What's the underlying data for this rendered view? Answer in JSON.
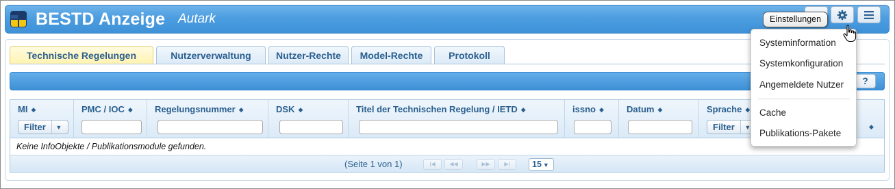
{
  "app": {
    "title": "BESTD Anzeige",
    "subtitle": "Autark"
  },
  "header": {
    "tooltip": "Einstellungen",
    "buttons": [
      {
        "icon": "gear-icon"
      },
      {
        "icon": "hamburger-menu-icon"
      }
    ]
  },
  "tabs": [
    {
      "label": "Technische Regelungen",
      "active": true
    },
    {
      "label": "Nutzerverwaltung",
      "active": false
    },
    {
      "label": "Nutzer-Rechte",
      "active": false
    },
    {
      "label": "Model-Rechte",
      "active": false
    },
    {
      "label": "Protokoll",
      "active": false
    }
  ],
  "toolbar": {
    "help_label": "?"
  },
  "grid": {
    "columns": [
      {
        "label": "MI",
        "filter": "select",
        "filter_label": "Filter"
      },
      {
        "label": "PMC / IOC",
        "filter": "text",
        "value": ""
      },
      {
        "label": "Regelungsnummer",
        "filter": "text",
        "value": ""
      },
      {
        "label": "DSK",
        "filter": "text",
        "value": ""
      },
      {
        "label": "Titel der Technischen Regelung / IETD",
        "filter": "text",
        "value": ""
      },
      {
        "label": "issno",
        "filter": "text",
        "value": ""
      },
      {
        "label": "Datum",
        "filter": "text",
        "value": ""
      },
      {
        "label": "Sprache",
        "filter": "select",
        "filter_label": "Filter"
      }
    ],
    "empty_message": "Keine InfoObjekte / Publikationsmodule gefunden.",
    "pager": {
      "info": "(Seite 1 von 1)",
      "page_size": "15"
    }
  },
  "menu": {
    "items": [
      "Systeminformation",
      "Systemkonfiguration",
      "Angemeldete Nutzer",
      "Cache",
      "Publikations-Pakete"
    ]
  },
  "colors": {
    "header_blue": "#4c9de0",
    "active_tab": "#fff3b0",
    "text_blue": "#2a5f8f"
  }
}
